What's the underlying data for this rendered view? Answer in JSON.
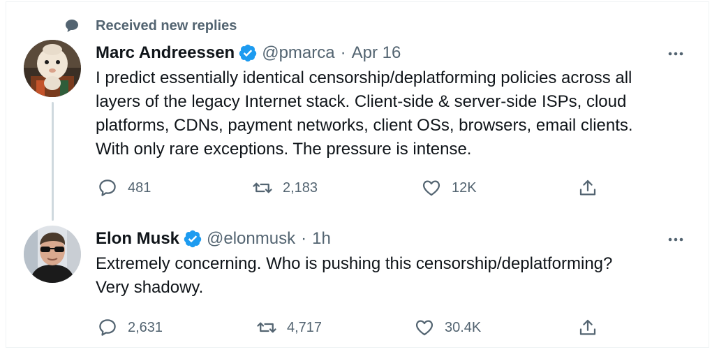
{
  "context": {
    "icon": "speech-bubble-icon",
    "text": "Received new replies"
  },
  "tweets": [
    {
      "name": "Marc Andreessen",
      "handle": "@pmarca",
      "separator": "·",
      "time": "Apr 16",
      "text": "I predict essentially identical censorship/deplatforming policies across all\nlayers of the legacy Internet stack. Client-side & server-side ISPs, cloud\nplatforms, CDNs, payment networks, client OSs, browsers, email clients.\nWith only rare exceptions. The pressure is intense.",
      "replies": "481",
      "retweets": "2,183",
      "likes": "12K"
    },
    {
      "name": "Elon Musk",
      "handle": "@elonmusk",
      "separator": "·",
      "time": "1h",
      "text": "Extremely concerning. Who is pushing this censorship/deplatforming?\nVery shadowy.",
      "replies": "2,631",
      "retweets": "4,717",
      "likes": "30.4K"
    }
  ],
  "colors": {
    "verified": "#1d9bf0",
    "secondary_text": "#536471",
    "primary_text": "#0f1419",
    "thread_line": "#cfd9de"
  }
}
